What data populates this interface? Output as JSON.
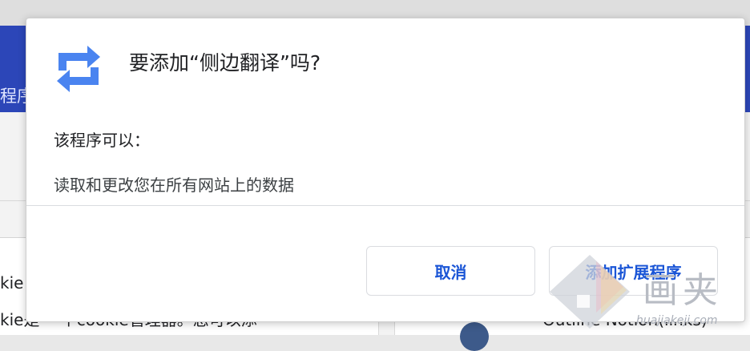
{
  "background": {
    "banner_text": "程序",
    "left_text_1": "kie",
    "left_text_2": "kie是 一个cookie管理器。您可以添",
    "right_text": "Outline Notion(links)"
  },
  "dialog": {
    "icon": "swap-arrows-icon",
    "title": "要添加“侧边翻译”吗?",
    "permissions_heading": "该程序可以：",
    "permissions": [
      "读取和更改您在所有网站上的数据"
    ],
    "cancel_label": "取消",
    "add_label": "添加扩展程序"
  },
  "watermark": {
    "text": "画夹",
    "url": "huajiakeji.com"
  },
  "colors": {
    "banner": "#2c46b8",
    "accent": "#1a55d6",
    "icon_blue": "#4a84f0"
  }
}
